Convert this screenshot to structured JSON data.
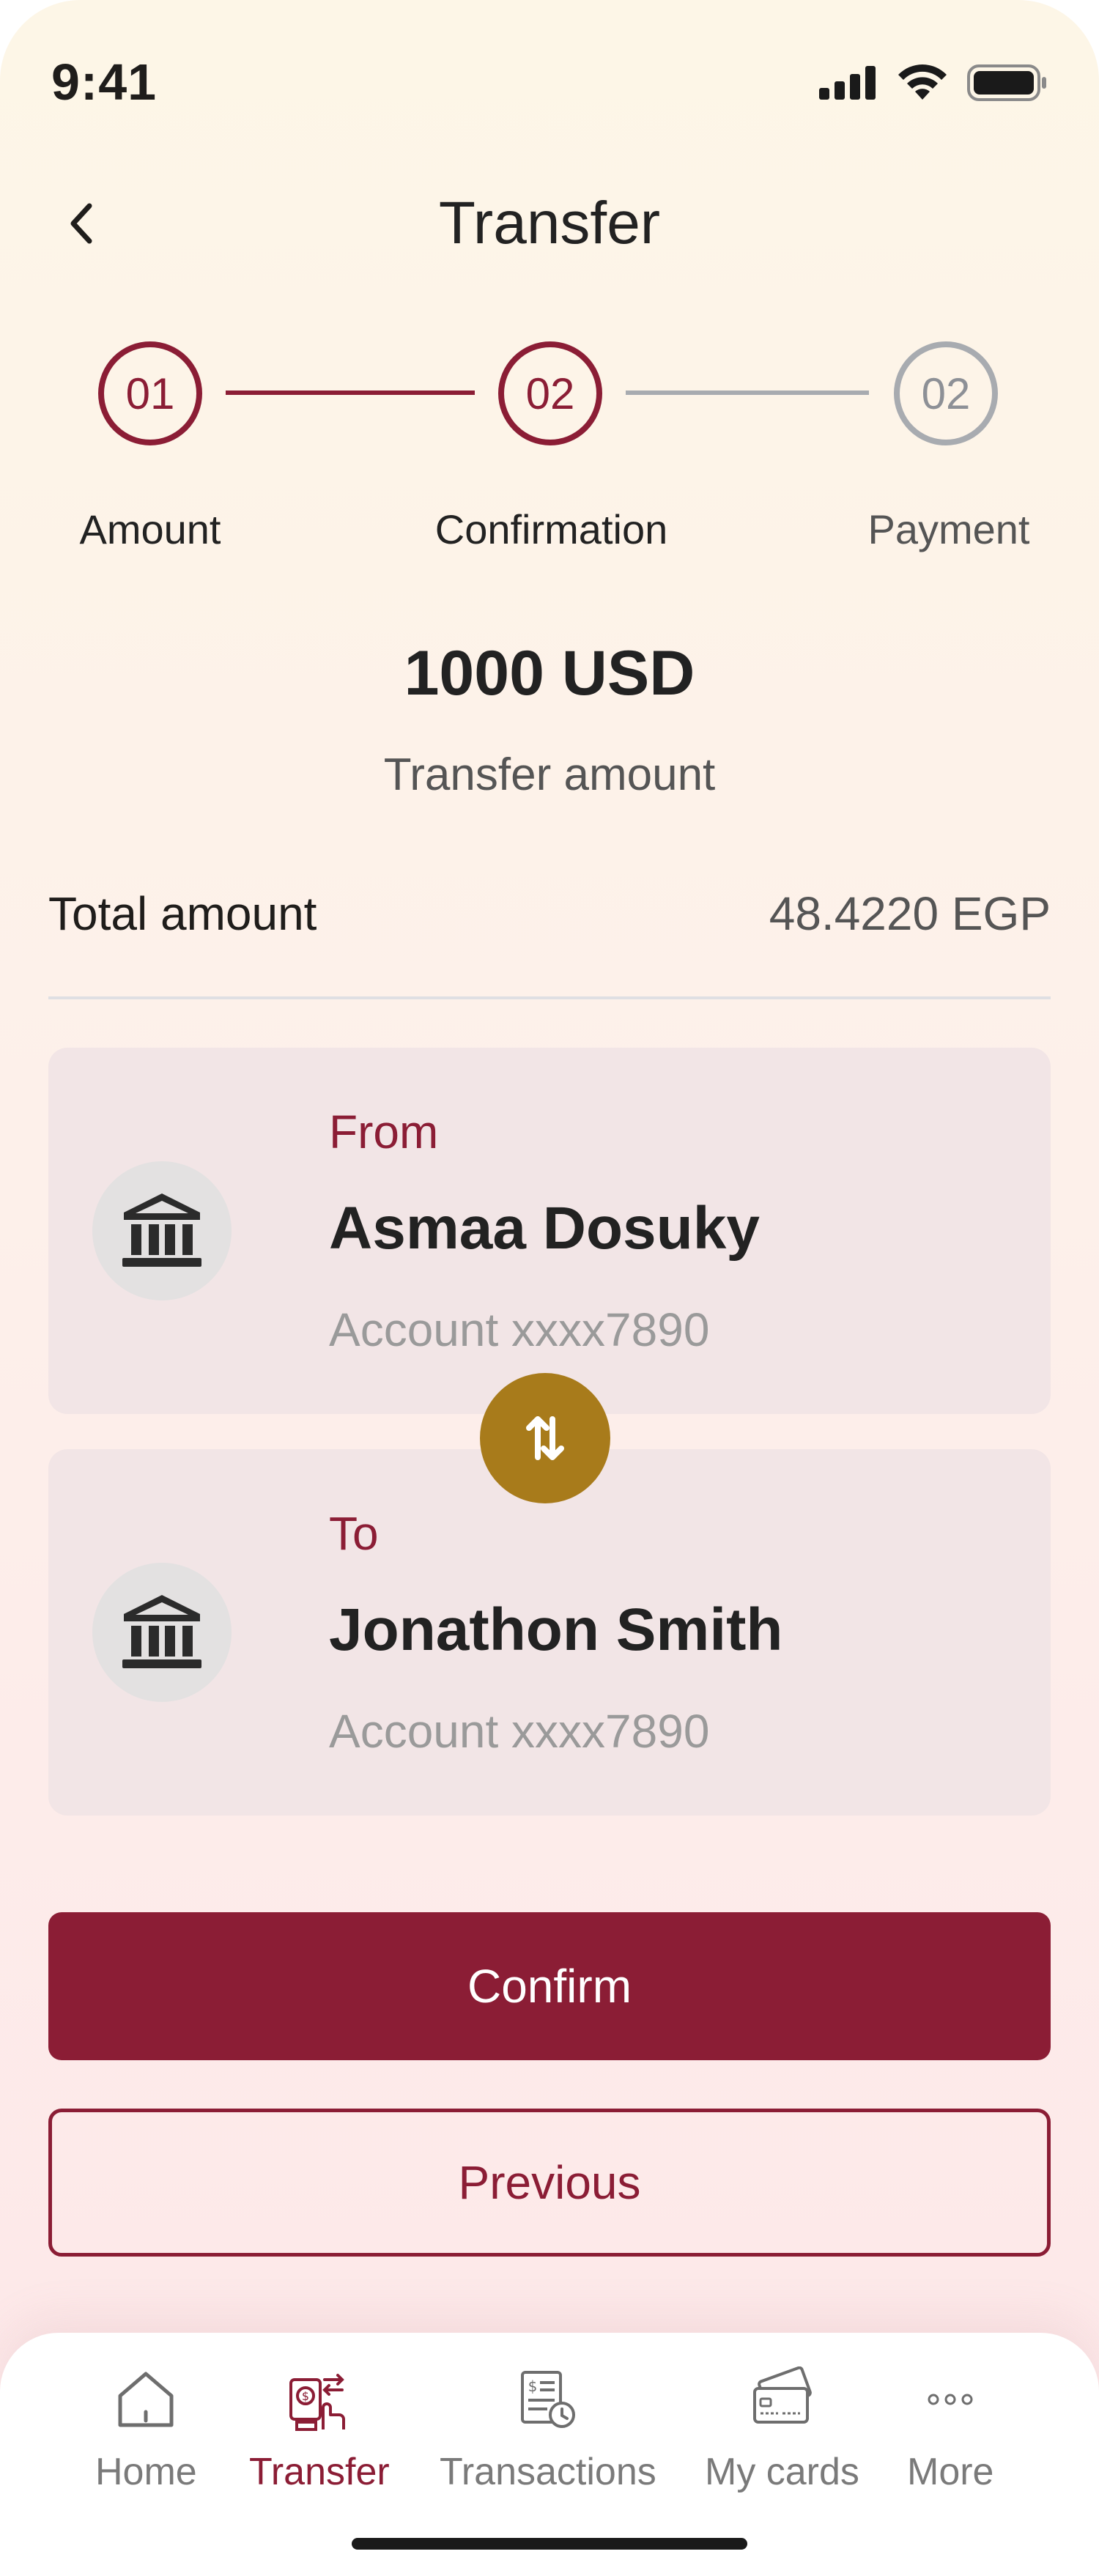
{
  "status_bar": {
    "time": "9:41"
  },
  "header": {
    "title": "Transfer"
  },
  "stepper": {
    "steps": [
      {
        "number": "01",
        "label": "Amount",
        "state": "done"
      },
      {
        "number": "02",
        "label": "Confirmation",
        "state": "current"
      },
      {
        "number": "02",
        "label": "Payment",
        "state": "upcoming"
      }
    ]
  },
  "transfer": {
    "amount": "1000 USD",
    "amount_caption": "Transfer amount",
    "total_label": "Total amount",
    "total_value": "48.4220 EGP"
  },
  "from_account": {
    "direction": "From",
    "name": "Asmaa Dosuky",
    "account": "Account xxxx7890"
  },
  "to_account": {
    "direction": "To",
    "name": "Jonathon Smith",
    "account": "Account xxxx7890"
  },
  "actions": {
    "confirm_label": "Confirm",
    "previous_label": "Previous"
  },
  "bottom_nav": {
    "items": [
      {
        "label": "Home",
        "icon": "home-icon",
        "active": false
      },
      {
        "label": "Transfer",
        "icon": "transfer-icon",
        "active": true
      },
      {
        "label": "Transactions",
        "icon": "transactions-icon",
        "active": false
      },
      {
        "label": "My cards",
        "icon": "cards-icon",
        "active": false
      },
      {
        "label": "More",
        "icon": "more-icon",
        "active": false
      }
    ]
  },
  "colors": {
    "primary": "#8b1d35",
    "accent_gold": "#a87b1b",
    "inactive": "#a8abb0",
    "card_bg": "#f2e5e6"
  }
}
